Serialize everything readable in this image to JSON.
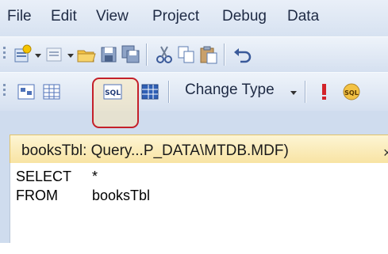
{
  "menu": {
    "items": [
      "File",
      "Edit",
      "View",
      "Project",
      "Debug",
      "Data"
    ]
  },
  "toolbar2": {
    "change_type_label": "Change Type"
  },
  "document_tab": {
    "title": "booksTbl: Query...P_DATA\\MTDB.MDF)",
    "close_glyph": "×"
  },
  "sql_editor": {
    "line1_keyword": "SELECT",
    "line1_arg": "*",
    "line2_keyword": "FROM",
    "line2_arg": "booksTbl"
  },
  "colors": {
    "highlight_border": "#c4202a",
    "tab_background": "#f8e3a2",
    "chrome_background": "#cfdcee"
  },
  "icons": {
    "toolbar1": [
      "add-new-item-icon",
      "dropdown-arrow-icon",
      "add-item-icon",
      "dropdown-arrow-icon",
      "open-folder-icon",
      "save-icon",
      "save-all-icon",
      "cut-icon",
      "copy-icon",
      "paste-icon",
      "undo-icon"
    ],
    "toolbar2": [
      "show-diagram-pane-icon",
      "show-criteria-pane-icon",
      "show-sql-pane-icon",
      "show-results-pane-icon",
      "execute-sql-icon",
      "verify-sql-icon"
    ]
  }
}
